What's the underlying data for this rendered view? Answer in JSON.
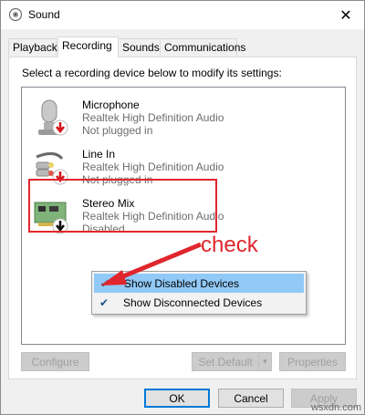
{
  "window": {
    "title": "Sound",
    "close_glyph": "✕"
  },
  "tabs": [
    {
      "label": "Playback",
      "active": false
    },
    {
      "label": "Recording",
      "active": true
    },
    {
      "label": "Sounds",
      "active": false
    },
    {
      "label": "Communications",
      "active": false
    }
  ],
  "panel": {
    "instruction": "Select a recording device below to modify its settings:"
  },
  "devices": [
    {
      "name": "Microphone",
      "driver": "Realtek High Definition Audio",
      "status": "Not plugged in",
      "icon": "microphone-icon"
    },
    {
      "name": "Line In",
      "driver": "Realtek High Definition Audio",
      "status": "Not plugged in",
      "icon": "line-in-icon"
    },
    {
      "name": "Stereo Mix",
      "driver": "Realtek High Definition Audio",
      "status": "Disabled",
      "icon": "sound-card-icon"
    }
  ],
  "context_menu": {
    "items": [
      {
        "label": "Show Disabled Devices",
        "checked": true,
        "highlighted": true
      },
      {
        "label": "Show Disconnected Devices",
        "checked": true,
        "highlighted": false
      }
    ],
    "check_glyph": "✔"
  },
  "annotation": {
    "text": "check",
    "color": "#e0262d"
  },
  "buttons": {
    "configure": "Configure",
    "set_default": "Set Default",
    "properties": "Properties",
    "ok": "OK",
    "cancel": "Cancel",
    "apply": "Apply"
  },
  "watermark": "wsxdn.com"
}
